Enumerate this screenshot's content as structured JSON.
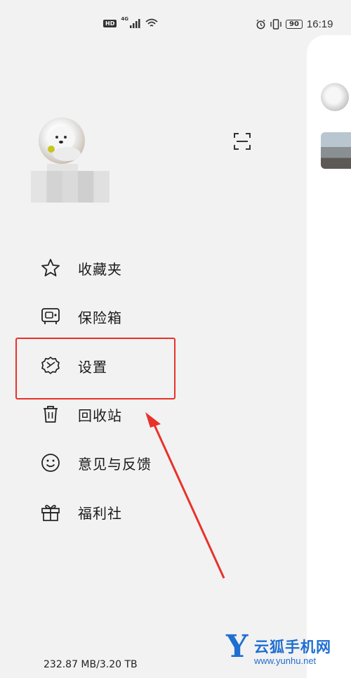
{
  "status_bar": {
    "network_badge": "HD",
    "network_type": "4G",
    "battery": "90",
    "time": "16:19",
    "icons": [
      "signal-icon",
      "wifi-icon",
      "alarm-icon",
      "vibrate-icon",
      "battery-icon"
    ]
  },
  "menu": {
    "items": [
      {
        "label": "收藏夹",
        "icon": "star-icon"
      },
      {
        "label": "保险箱",
        "icon": "safe-icon"
      },
      {
        "label": "设置",
        "icon": "settings-icon"
      },
      {
        "label": "回收站",
        "icon": "trash-icon"
      },
      {
        "label": "意见与反馈",
        "icon": "smiley-icon"
      },
      {
        "label": "福利社",
        "icon": "gift-icon"
      }
    ]
  },
  "storage": {
    "usage": "232.87 MB/3.20 TB"
  },
  "watermark": {
    "letter": "Y",
    "name": "云狐手机网",
    "url": "www.yunhu.net"
  },
  "colors": {
    "background": "#f2f2f2",
    "highlight": "#e8322b",
    "watermark": "#1f6fd1"
  }
}
